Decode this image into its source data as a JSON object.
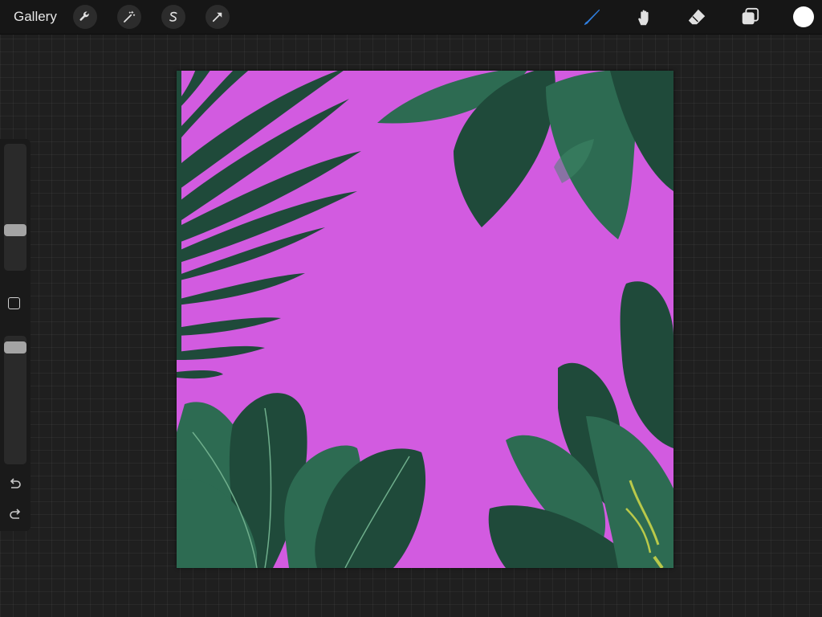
{
  "topbar": {
    "gallery_label": "Gallery",
    "left_tools": [
      {
        "name": "actions",
        "icon": "wrench-icon"
      },
      {
        "name": "adjustments",
        "icon": "magic-wand-icon"
      },
      {
        "name": "selection",
        "icon": "selection-s-icon"
      },
      {
        "name": "transform",
        "icon": "arrow-cursor-icon"
      }
    ],
    "right_tools": [
      {
        "name": "brush",
        "icon": "brush-icon",
        "active": true
      },
      {
        "name": "smudge",
        "icon": "smudge-finger-icon"
      },
      {
        "name": "eraser",
        "icon": "eraser-icon"
      },
      {
        "name": "layers",
        "icon": "layers-icon"
      }
    ],
    "current_color": "#ffffff",
    "active_tool_color": "#2f7fe0"
  },
  "sidebar": {
    "brush_size_level": 0.3,
    "opacity_level": 0.95,
    "icons": [
      "square-modify-icon",
      "undo-icon",
      "redo-icon"
    ]
  },
  "canvas": {
    "background_color": "#d25be0",
    "leaf_dark": "#1f4a3a",
    "leaf_mid": "#2d6b52",
    "leaf_light": "#3f8a68"
  }
}
